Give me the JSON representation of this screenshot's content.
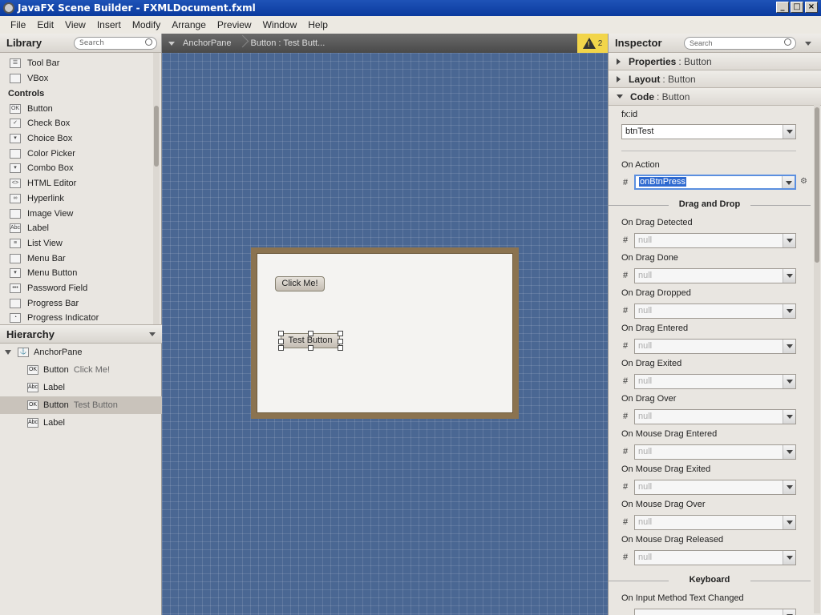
{
  "window": {
    "title": "JavaFX Scene Builder - FXMLDocument.fxml",
    "controls": [
      "_",
      "□",
      "×"
    ]
  },
  "menu": [
    "File",
    "Edit",
    "View",
    "Insert",
    "Modify",
    "Arrange",
    "Preview",
    "Window",
    "Help"
  ],
  "library": {
    "title": "Library",
    "search_placeholder": "Search",
    "items_top": [
      {
        "label": "Tool Bar",
        "icon": "toolbar-icon",
        "glyph": "☰"
      },
      {
        "label": "VBox",
        "icon": "vbox-icon",
        "glyph": ""
      }
    ],
    "category": "Controls",
    "items": [
      {
        "label": "Button",
        "icon": "button-icon",
        "glyph": "OK"
      },
      {
        "label": "Check Box",
        "icon": "checkbox-icon",
        "glyph": "✓"
      },
      {
        "label": "Choice Box",
        "icon": "choicebox-icon",
        "glyph": "▾"
      },
      {
        "label": "Color Picker",
        "icon": "colorpicker-icon",
        "glyph": ""
      },
      {
        "label": "Combo Box",
        "icon": "combobox-icon",
        "glyph": "▾"
      },
      {
        "label": "HTML Editor",
        "icon": "htmleditor-icon",
        "glyph": "<>"
      },
      {
        "label": "Hyperlink",
        "icon": "hyperlink-icon",
        "glyph": "∞"
      },
      {
        "label": "Image View",
        "icon": "imageview-icon",
        "glyph": ""
      },
      {
        "label": "Label",
        "icon": "label-icon",
        "glyph": "Abc"
      },
      {
        "label": "List View",
        "icon": "listview-icon",
        "glyph": "≡"
      },
      {
        "label": "Menu Bar",
        "icon": "menubar-icon",
        "glyph": ""
      },
      {
        "label": "Menu Button",
        "icon": "menubutton-icon",
        "glyph": "▾"
      },
      {
        "label": "Password Field",
        "icon": "passwordfield-icon",
        "glyph": "•••"
      },
      {
        "label": "Progress Bar",
        "icon": "progressbar-icon",
        "glyph": ""
      },
      {
        "label": "Progress Indicator",
        "icon": "progressindicator-icon",
        "glyph": "◔"
      }
    ]
  },
  "hierarchy": {
    "title": "Hierarchy",
    "root": "AnchorPane",
    "rows": [
      {
        "type": "Button",
        "detail": "Click Me!",
        "glyph": "OK",
        "selected": false
      },
      {
        "type": "Label",
        "detail": "",
        "glyph": "Abc",
        "selected": false
      },
      {
        "type": "Button",
        "detail": "Test Button",
        "glyph": "OK",
        "selected": true
      },
      {
        "type": "Label",
        "detail": "",
        "glyph": "Abc",
        "selected": false
      }
    ]
  },
  "breadcrumb": {
    "items": [
      "AnchorPane",
      "Button : Test Butt..."
    ]
  },
  "warnings": {
    "count": "2"
  },
  "canvas": {
    "buttons": {
      "click_me": "Click Me!",
      "test": "Test Button"
    }
  },
  "inspector": {
    "title": "Inspector",
    "search_placeholder": "Search",
    "sections": [
      {
        "name": "Properties",
        "target": "Button",
        "expanded": false
      },
      {
        "name": "Layout",
        "target": "Button",
        "expanded": false
      },
      {
        "name": "Code",
        "target": "Button",
        "expanded": true
      }
    ],
    "code": {
      "fxid_label": "fx:id",
      "fxid_value": "btnTest",
      "on_action_label": "On Action",
      "on_action_value": "onBtnPress",
      "hash": "#",
      "drag_and_drop_heading": "Drag and Drop",
      "events": [
        {
          "label": "On Drag Detected",
          "value": "null"
        },
        {
          "label": "On Drag Done",
          "value": "null"
        },
        {
          "label": "On Drag Dropped",
          "value": "null"
        },
        {
          "label": "On Drag Entered",
          "value": "null"
        },
        {
          "label": "On Drag Exited",
          "value": "null"
        },
        {
          "label": "On Drag Over",
          "value": "null"
        },
        {
          "label": "On Mouse Drag Entered",
          "value": "null"
        },
        {
          "label": "On Mouse Drag Exited",
          "value": "null"
        },
        {
          "label": "On Mouse Drag Over",
          "value": "null"
        },
        {
          "label": "On Mouse Drag Released",
          "value": "null"
        }
      ],
      "keyboard_heading": "Keyboard",
      "keyboard_events": [
        {
          "label": "On Input Method Text Changed"
        }
      ]
    }
  }
}
